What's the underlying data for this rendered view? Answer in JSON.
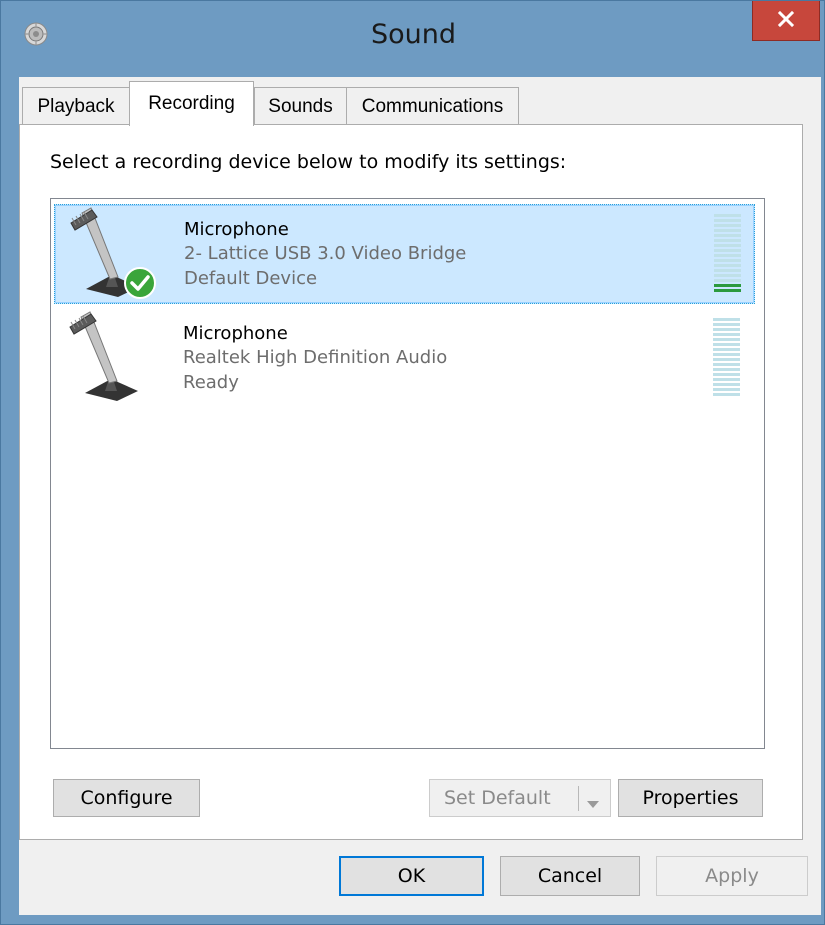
{
  "window": {
    "title": "Sound",
    "icons": {
      "app": "speaker-icon",
      "close": "close-icon"
    }
  },
  "tabs": [
    {
      "label": "Playback",
      "active": false
    },
    {
      "label": "Recording",
      "active": true
    },
    {
      "label": "Sounds",
      "active": false
    },
    {
      "label": "Communications",
      "active": false
    }
  ],
  "panel": {
    "instruction": "Select a recording device below to modify its settings:"
  },
  "devices": [
    {
      "name": "Microphone",
      "description": "2- Lattice USB 3.0 Video Bridge",
      "status": "Default Device",
      "selected": true,
      "is_default": true,
      "icon": "microphone-icon",
      "level_segments_active": 2
    },
    {
      "name": "Microphone",
      "description": "Realtek High Definition Audio",
      "status": "Ready",
      "selected": false,
      "is_default": false,
      "icon": "microphone-icon",
      "level_segments_active": 0
    }
  ],
  "buttons": {
    "configure": "Configure",
    "set_default": "Set Default",
    "properties": "Properties",
    "ok": "OK",
    "cancel": "Cancel",
    "apply": "Apply"
  },
  "colors": {
    "title_bar": "#6e9bc2",
    "close_button": "#c7473c",
    "selection": "#cce8ff",
    "meter_active": "#2c9a3e",
    "meter_inactive": "#bfe0e8"
  }
}
